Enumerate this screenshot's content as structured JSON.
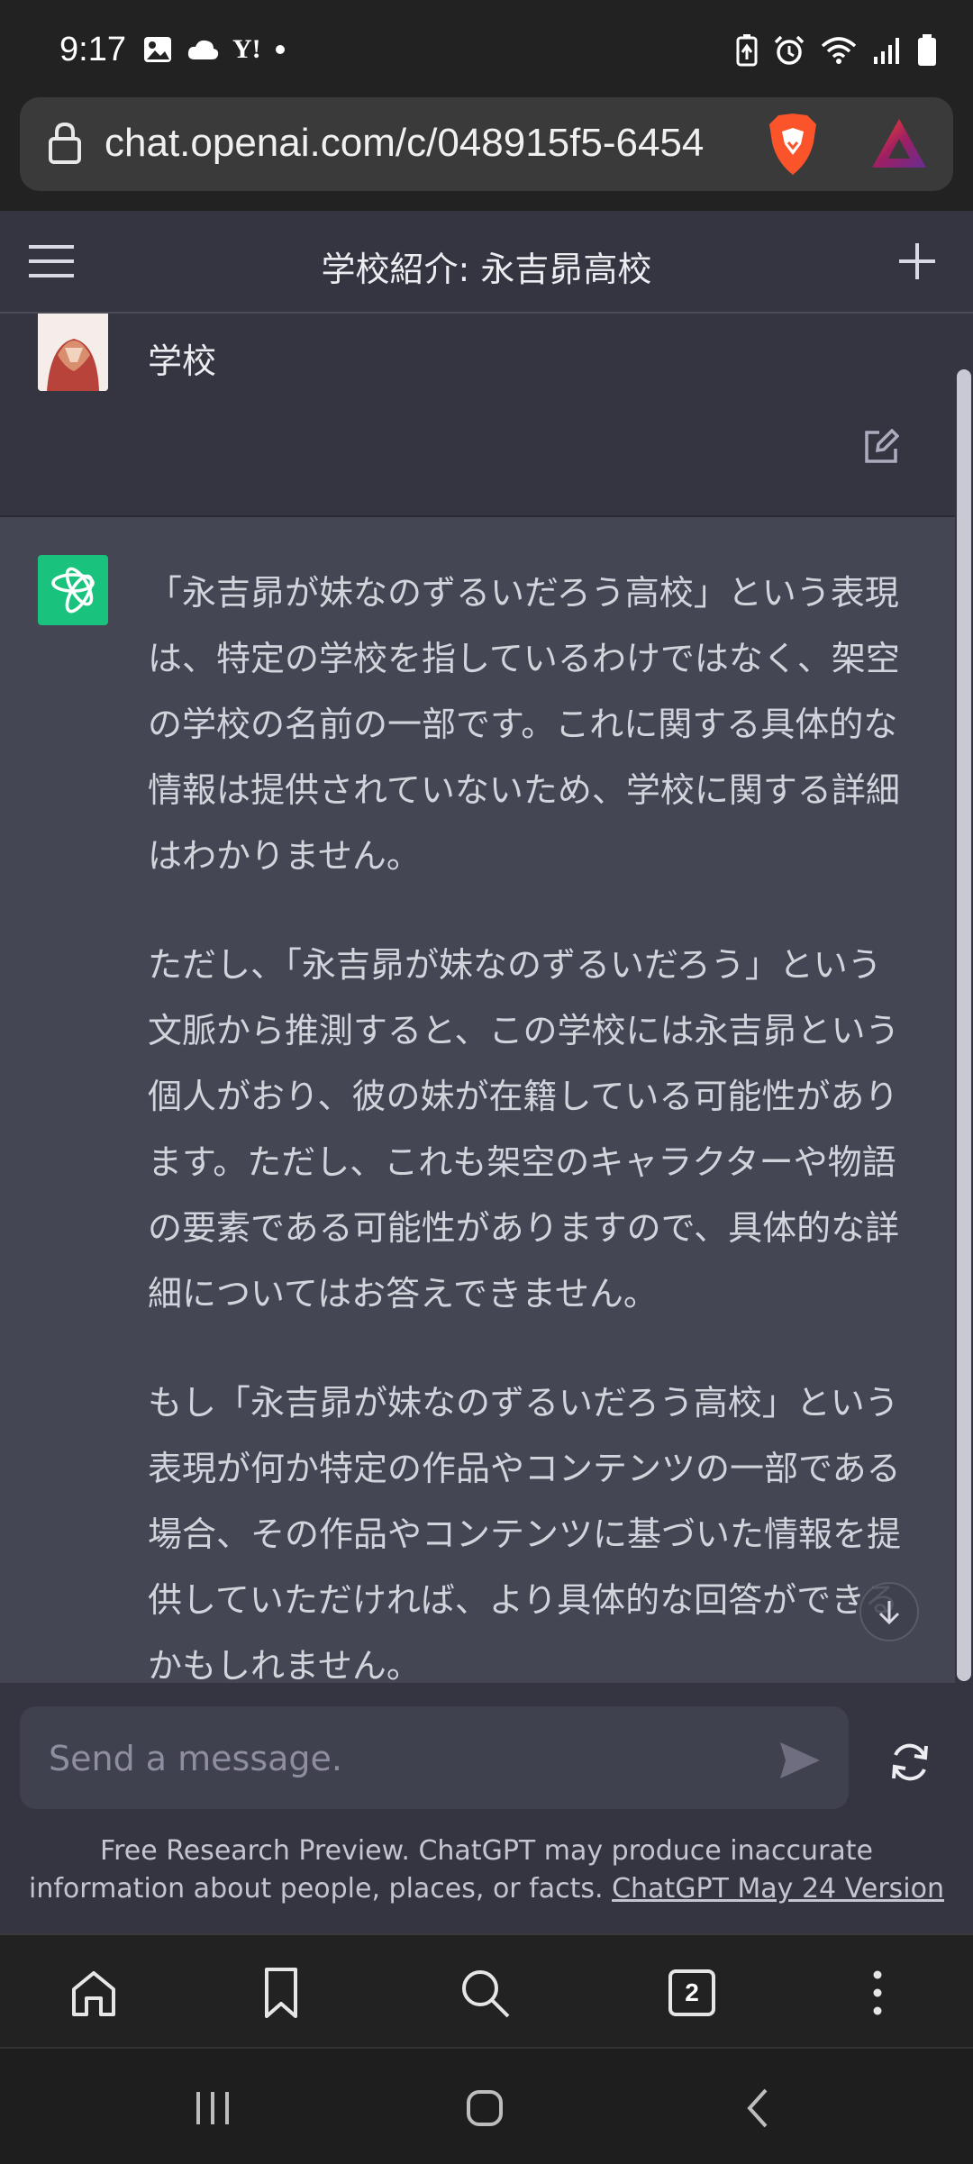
{
  "status_bar": {
    "time": "9:17",
    "left_icons": [
      "gallery-icon",
      "cloud-icon",
      "yahoo-icon",
      "dot-icon"
    ],
    "yahoo_text": "Y!",
    "right_icons": [
      "battery-saver-icon",
      "alarm-icon",
      "wifi-icon",
      "signal-icon",
      "battery-icon"
    ]
  },
  "browser": {
    "url": "chat.openai.com/c/048915f5-6454",
    "tab_count": "2"
  },
  "chat": {
    "title": "学校紹介: 永吉昴高校",
    "user_message": "「永吉昴が妹なのずるいだろう高校」ってどんな学校",
    "assistant_paragraphs": [
      "「永吉昴が妹なのずるいだろう高校」という表現は、特定の学校を指しているわけではなく、架空の学校の名前の一部です。これに関する具体的な情報は提供されていないため、学校に関する詳細はわかりません。",
      "ただし、「永吉昴が妹なのずるいだろう」という文脈から推測すると、この学校には永吉昴という個人がおり、彼の妹が在籍している可能性があります。ただし、これも架空のキャラクターや物語の要素である可能性がありますので、具体的な詳細についてはお答えできません。",
      "もし「永吉昴が妹なのずるいだろう高校」という表現が何か特定の作品やコンテンツの一部である場合、その作品やコンテンツに基づいた情報を提供していただければ、より具体的な回答ができるかもしれません。"
    ]
  },
  "composer": {
    "placeholder": "Send a message.",
    "value": ""
  },
  "disclaimer": {
    "text": "Free Research Preview. ChatGPT may produce inaccurate information about people, places, or facts. ",
    "link": "ChatGPT May 24 Version"
  },
  "colors": {
    "gpt_green": "#19c37d",
    "assistant_bg": "#444654",
    "page_bg": "#343541",
    "brave_orange": "#fb542b"
  }
}
